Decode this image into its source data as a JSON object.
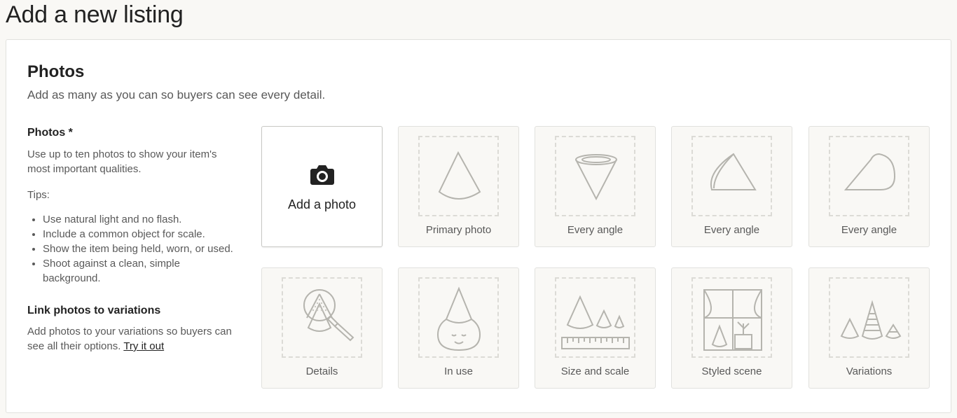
{
  "page": {
    "title": "Add a new listing"
  },
  "photos_section": {
    "title": "Photos",
    "subtitle": "Add as many as you can so buyers can see every detail.",
    "field_label": "Photos *",
    "help": "Use up to ten photos to show your item's most important qualities.",
    "tips_label": "Tips:",
    "tips": [
      "Use natural light and no flash.",
      "Include a common object for scale.",
      "Show the item being held, worn, or used.",
      "Shoot against a clean, simple background."
    ],
    "variations_title": "Link photos to variations",
    "variations_text": "Add photos to your variations so buyers can see all their options.",
    "variations_link": "Try it out"
  },
  "tiles": {
    "add_label": "Add a photo",
    "primary": "Primary photo",
    "angle_1": "Every angle",
    "angle_2": "Every angle",
    "angle_3": "Every angle",
    "details": "Details",
    "in_use": "In use",
    "size_scale": "Size and scale",
    "styled_scene": "Styled scene",
    "variations": "Variations"
  },
  "icons": {
    "camera": "camera-icon",
    "placeholder_stroke": "#b5b4ae"
  }
}
